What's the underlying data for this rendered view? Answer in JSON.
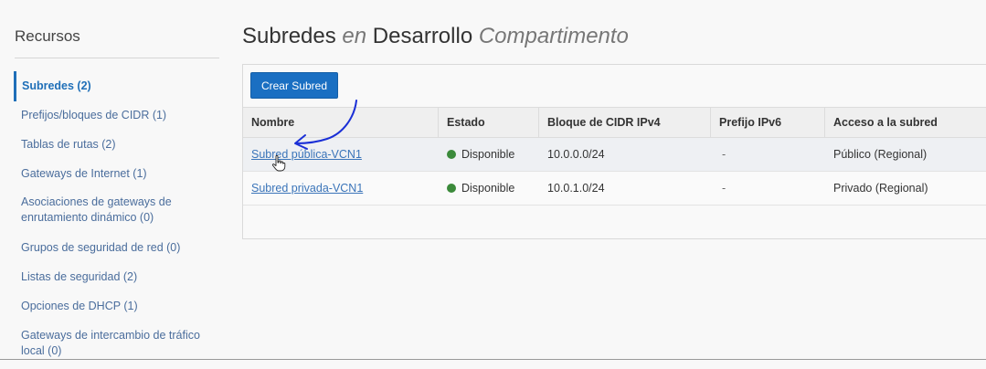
{
  "sidebar": {
    "title": "Recursos",
    "items": [
      {
        "label": "Subredes (2)",
        "active": true
      },
      {
        "label": "Prefijos/bloques de CIDR (1)"
      },
      {
        "label": "Tablas de rutas (2)"
      },
      {
        "label": "Gateways de Internet (1)"
      },
      {
        "label": "Asociaciones de gateways de enrutamiento dinámico (0)"
      },
      {
        "label": "Grupos de seguridad de red (0)"
      },
      {
        "label": "Listas de seguridad (2)"
      },
      {
        "label": "Opciones de DHCP (1)"
      },
      {
        "label": "Gateways de intercambio de tráfico local (0)"
      }
    ]
  },
  "header": {
    "title_part1": "Subredes",
    "title_en": "en",
    "title_part2": "Desarrollo",
    "title_part3": "Compartimento"
  },
  "toolbar": {
    "create_label": "Crear Subred"
  },
  "table": {
    "columns": [
      "Nombre",
      "Estado",
      "Bloque de CIDR IPv4",
      "Prefijo IPv6",
      "Acceso a la subred"
    ],
    "rows": [
      {
        "name": "Subred pública-VCN1",
        "state": "Disponible",
        "cidr": "10.0.0.0/24",
        "ipv6": "-",
        "access": "Público (Regional)"
      },
      {
        "name": "Subred privada-VCN1",
        "state": "Disponible",
        "cidr": "10.0.1.0/24",
        "ipv6": "-",
        "access": "Privado (Regional)"
      }
    ]
  },
  "colors": {
    "accent": "#1a6fc2",
    "status_available": "#3b8a3a",
    "annotation": "#1a2fd6"
  }
}
